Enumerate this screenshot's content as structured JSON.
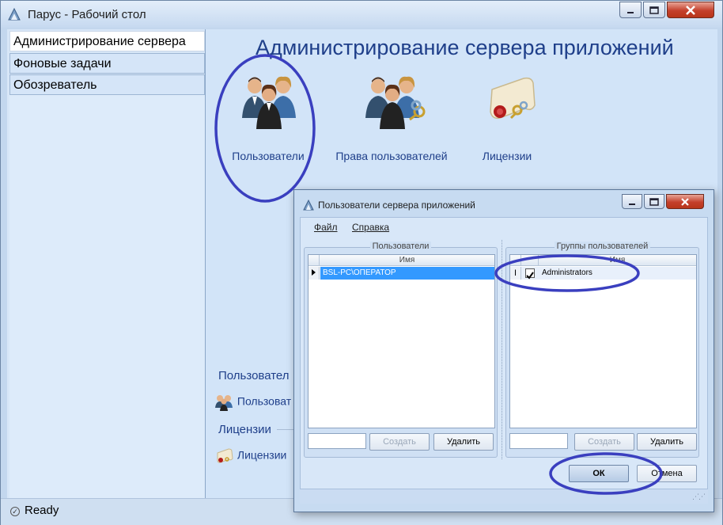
{
  "window": {
    "title": "Парус - Рабочий стол"
  },
  "nav": {
    "items": [
      {
        "label": "Администрирование сервера"
      },
      {
        "label": "Фоновые задачи"
      },
      {
        "label": "Обозреватель"
      }
    ]
  },
  "pane": {
    "title": "Администрирование сервера приложений",
    "tiles": [
      {
        "label": "Пользователи",
        "icon": "users-icon"
      },
      {
        "label": "Права пользователей",
        "icon": "user-rights-icon"
      },
      {
        "label": "Лицензии",
        "icon": "license-icon"
      }
    ],
    "sections": [
      {
        "heading": "Пользовател",
        "link": "Пользоват"
      },
      {
        "heading": "Лицензии",
        "link": "Лицензии"
      }
    ]
  },
  "status": {
    "text": "Ready"
  },
  "dialog": {
    "title": "Пользователи сервера приложений",
    "menu": [
      {
        "label": "Файл"
      },
      {
        "label": "Справка"
      }
    ],
    "users_group": {
      "caption": "Пользователи",
      "column": "Имя",
      "rows": [
        {
          "name": "BSL-PC\\ОПЕРАТОР"
        }
      ],
      "create": "Создать",
      "delete": "Удалить"
    },
    "groups_group": {
      "caption": "Группы пользователей",
      "column": "Имя",
      "rows": [
        {
          "name": "Administrators",
          "checked": true
        }
      ],
      "create": "Создать",
      "delete": "Удалить"
    },
    "ok": "ОК",
    "cancel": "Отмена"
  },
  "colors": {
    "accent": "#1f3f8a",
    "annotation": "#3a3fbf",
    "selection": "#3399ff"
  }
}
